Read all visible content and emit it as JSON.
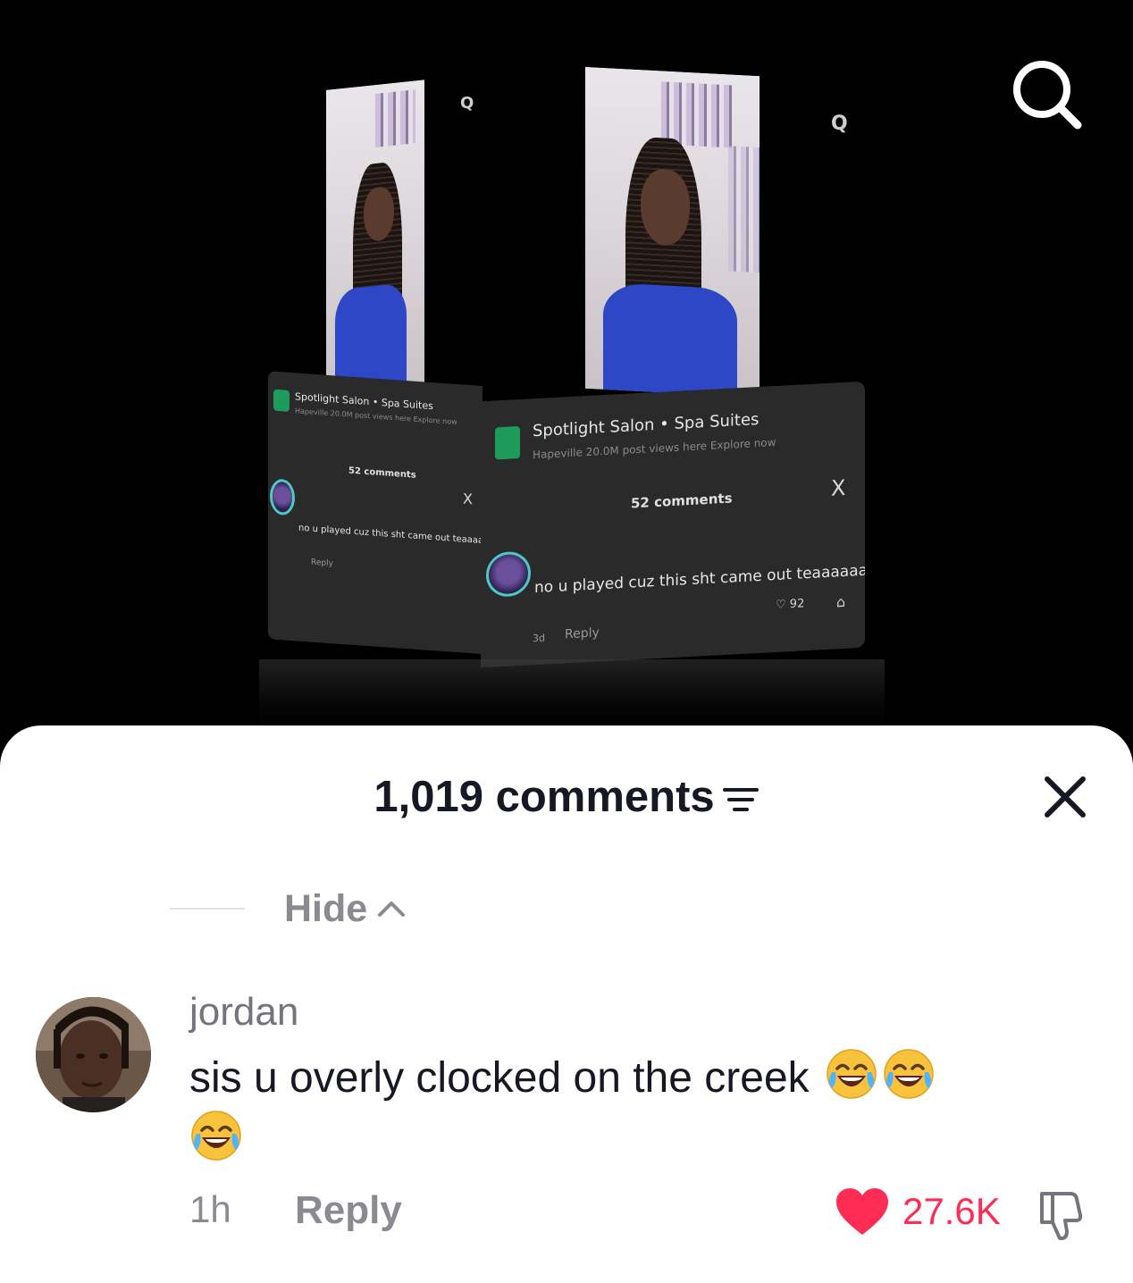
{
  "video": {
    "embedded_panel": {
      "account_name": "Spotlight Salon • Spa Suites",
      "subline": "Hapeville   20.0M post views here   Explore now",
      "comment_count_label": "52 comments",
      "close_label": "X",
      "comment_text": "no u played cuz this sht came out teaaaaaaaa",
      "comment_time": "3d",
      "reply_label": "Reply",
      "like_count": "92"
    },
    "mini_search_label": "Q"
  },
  "sheet": {
    "title": "1,019 comments",
    "hide_label": "Hide",
    "comment": {
      "username": "jordan",
      "text": "sis u overly clocked on the creek",
      "emoji_count": 3,
      "time": "1h",
      "reply_label": "Reply",
      "like_count": "27.6K"
    }
  },
  "colors": {
    "like": "#fe2c55",
    "text_primary": "#161823",
    "text_secondary": "#8a8b91"
  },
  "icons": [
    "search-icon",
    "filter-icon",
    "close-icon",
    "chevron-up-icon",
    "heart-icon",
    "dislike-icon",
    "tears-of-joy-emoji"
  ]
}
